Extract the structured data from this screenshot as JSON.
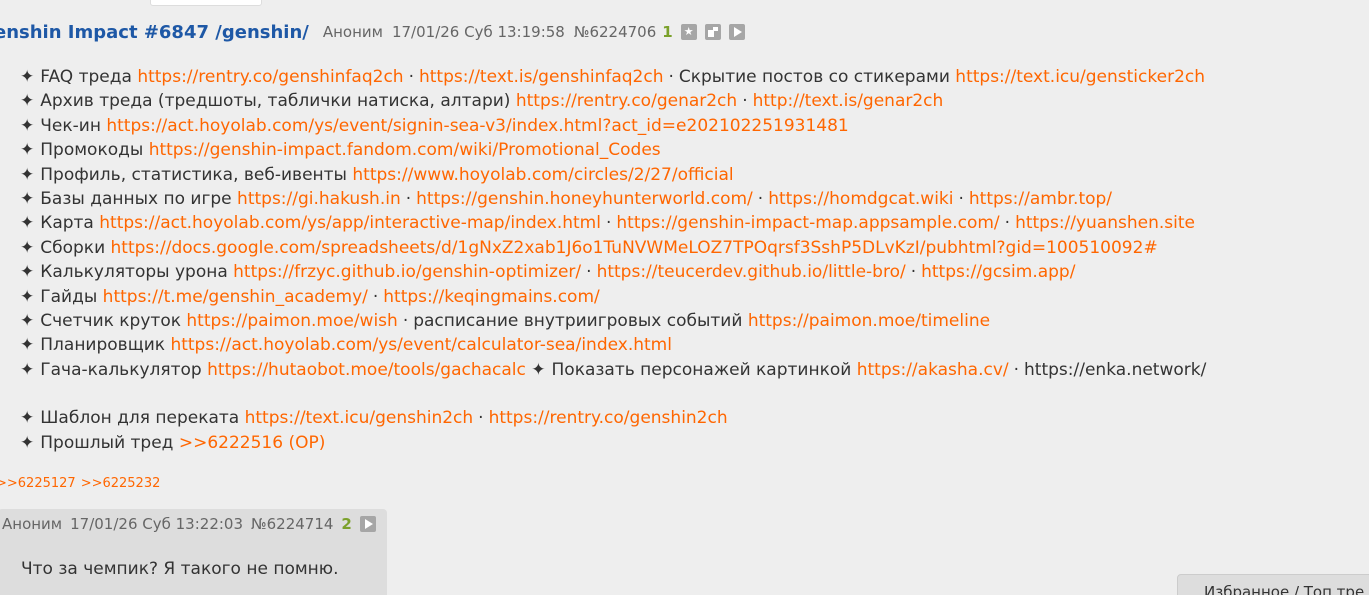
{
  "op": {
    "title": "enshin Impact #6847 /genshin/",
    "author": "Аноним",
    "date": "17/01/26 Суб 13:19:58",
    "num": "№6224706",
    "replies": "1"
  },
  "op_body": {
    "l1": {
      "label": "FAQ треда",
      "link1": "https://rentry.co/genshinfaq2ch",
      "link2": "https://text.is/genshinfaq2ch",
      "text3": "Скрытие постов со стикерами",
      "link3": "https://text.icu/gensticker2ch"
    },
    "l2": {
      "label": "Архив треда (тредшоты, таблички натиска, алтари)",
      "link1": "https://rentry.co/genar2ch",
      "link2": "http://text.is/genar2ch"
    },
    "l3": {
      "label": "Чек-ин",
      "link1": "https://act.hoyolab.com/ys/event/signin-sea-v3/index.html?act_id=e202102251931481"
    },
    "l4": {
      "label": "Промокоды",
      "link1": "https://genshin-impact.fandom.com/wiki/Promotional_Codes"
    },
    "l5": {
      "label": "Профиль, статистика, веб-ивенты",
      "link1": "https://www.hoyolab.com/circles/2/27/official"
    },
    "l6": {
      "label": "Базы данных по игре",
      "link1": "https://gi.hakush.in",
      "link2": "https://genshin.honeyhunterworld.com/",
      "link3": "https://homdgcat.wiki",
      "link4": "https://ambr.top/"
    },
    "l7": {
      "label": "Карта",
      "link1": "https://act.hoyolab.com/ys/app/interactive-map/index.html",
      "link2": "https://genshin-impact-map.appsample.com/",
      "link3": "https://yuanshen.site"
    },
    "l8": {
      "label": "Сборки",
      "link1": "https://docs.google.com/spreadsheets/d/1gNxZ2xab1J6o1TuNVWMeLOZ7TPOqrsf3SshP5DLvKzI/pubhtml?gid=100510092#"
    },
    "l9": {
      "label": "Калькуляторы урона",
      "link1": "https://frzyc.github.io/genshin-optimizer/",
      "link2": "https://teucerdev.github.io/little-bro/",
      "link3": "https://gcsim.app/"
    },
    "l10": {
      "label": "Гайды",
      "link1": "https://t.me/genshin_academy/",
      "link2": "https://keqingmains.com/"
    },
    "l11": {
      "label": "Счетчик круток",
      "link1": "https://paimon.moe/wish",
      "text2": "расписание внутриигровых событий",
      "link2": "https://paimon.moe/timeline"
    },
    "l12": {
      "label": "Планировщик",
      "link1": "https://act.hoyolab.com/ys/event/calculator-sea/index.html"
    },
    "l13": {
      "label": "Гача-калькулятор",
      "link1": "https://hutaobot.moe/tools/gachacalc",
      "text2": "Показать персонажей картинкой",
      "link2": "https://akasha.cv/",
      "text3": "https://enka.network/"
    },
    "l14": {
      "label": "Шаблон для переката",
      "link1": "https://text.icu/genshin2ch",
      "link2": "https://rentry.co/genshin2ch"
    },
    "l15": {
      "label": "Прошлый тред",
      "link1": ">>6222516 (OP)"
    }
  },
  "backrefs": [
    ">>6225127",
    ">>6225232"
  ],
  "reply": {
    "author": "Аноним",
    "date": "17/01/26 Суб 13:22:03",
    "num": "№6224714",
    "replies": "2",
    "text": "Что за чемпик? Я такого не помню."
  },
  "fav_panel": {
    "label": "Избранное / Топ тре"
  },
  "icons": {
    "star": "✦",
    "separator": "·"
  },
  "colors": {
    "link": "#ff6600",
    "title": "#1e58a6",
    "reply_count": "#7ba12b",
    "background": "#eeeeee",
    "reply_bg": "#dddddd"
  }
}
